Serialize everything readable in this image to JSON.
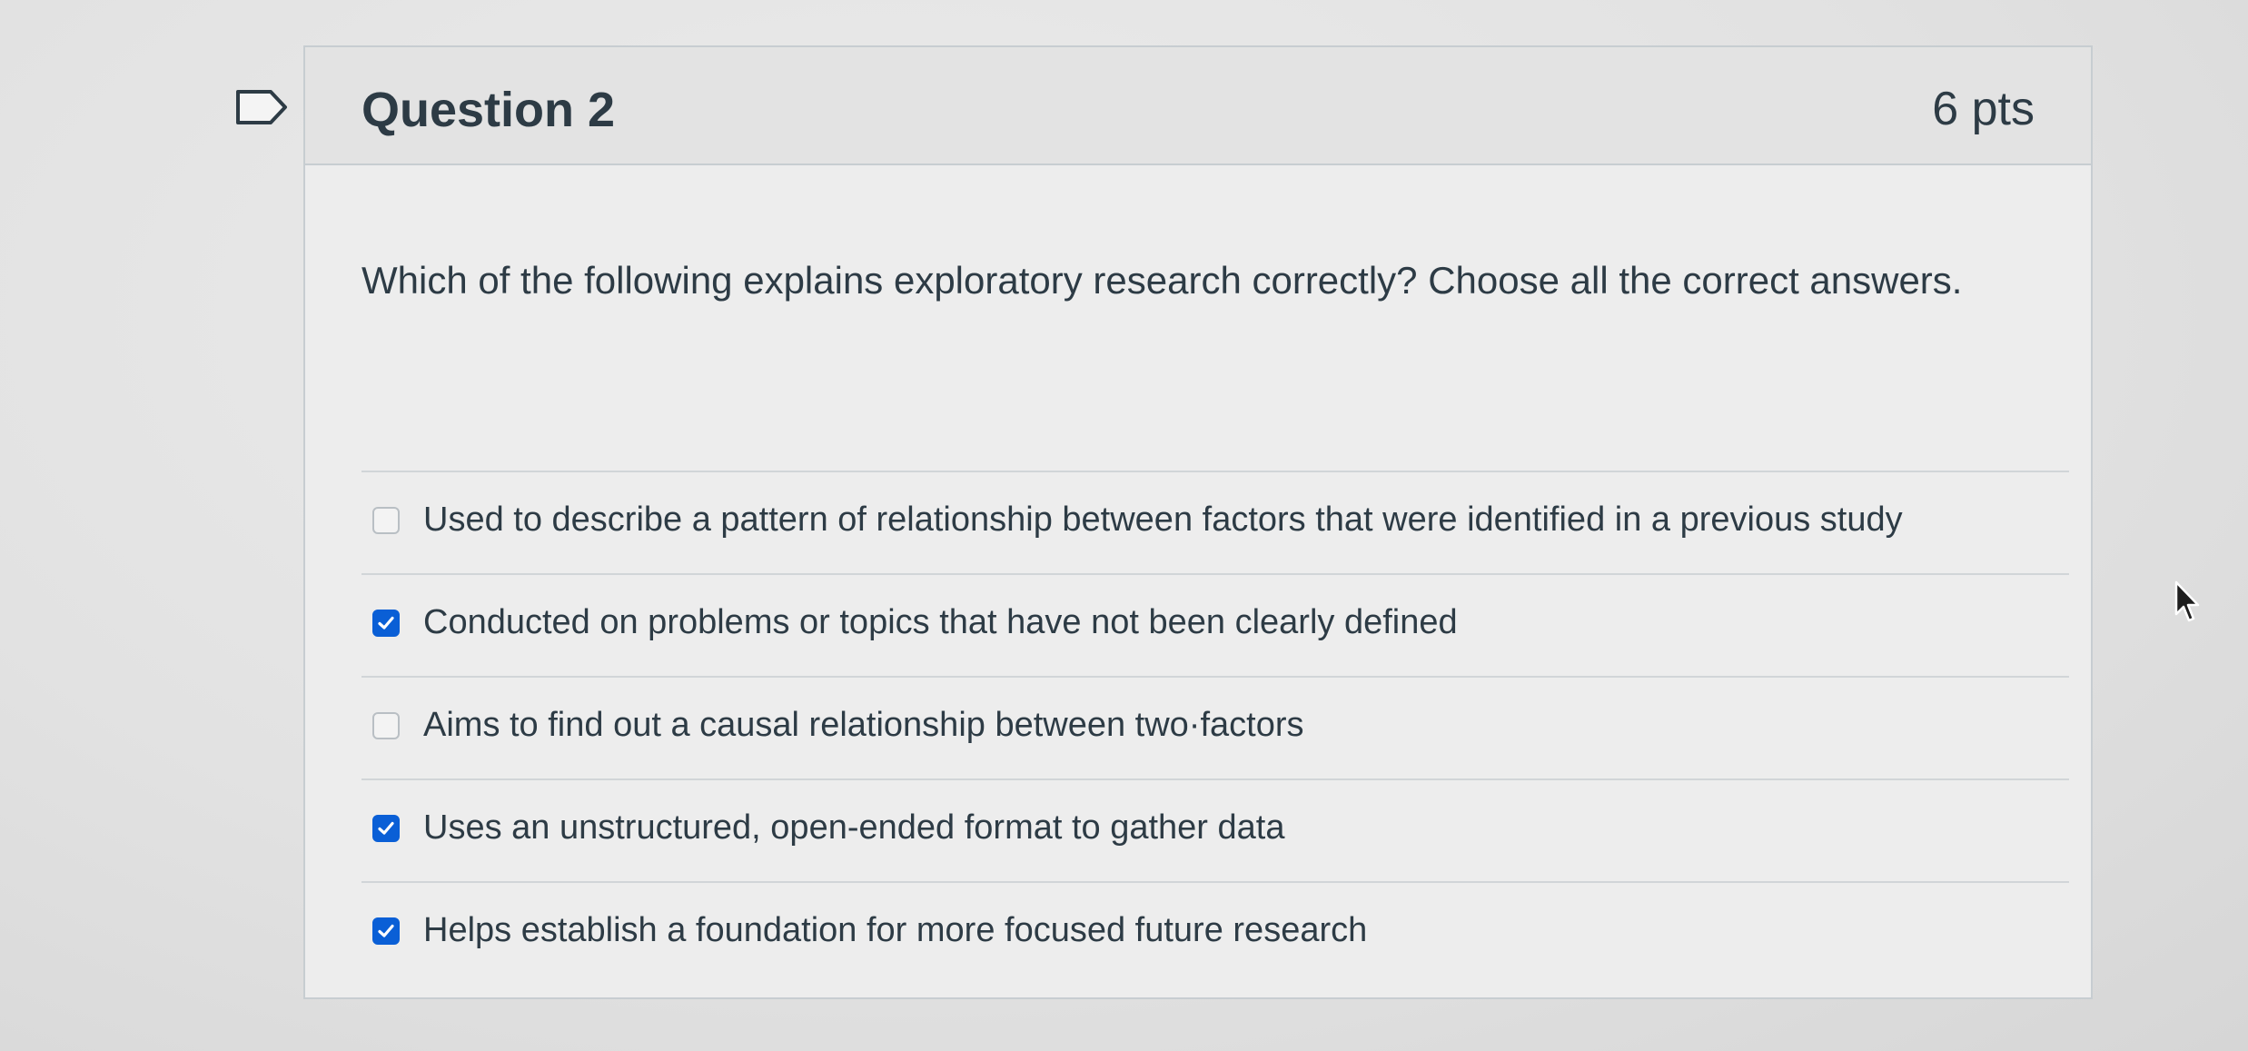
{
  "question": {
    "title": "Question 2",
    "points": "6 pts",
    "text": "Which of the following explains exploratory research correctly? Choose all the correct answers."
  },
  "answers": [
    {
      "label": "Used to describe a pattern of relationship between factors that were identified in a previous study",
      "checked": false
    },
    {
      "label": "Conducted on problems or topics that have not been clearly defined",
      "checked": true
    },
    {
      "label": "Aims to find out a causal relationship between two·factors",
      "checked": false
    },
    {
      "label": "Uses an unstructured, open-ended format to gather data",
      "checked": true
    },
    {
      "label": "Helps establish a foundation for more focused future research",
      "checked": true
    }
  ],
  "colors": {
    "accent": "#0a5fd6",
    "text": "#2d3b45",
    "border": "#c7cdd1"
  },
  "icons": {
    "flag": "bookmark-flag-icon",
    "check": "check-icon",
    "cursor": "mouse-pointer-icon"
  }
}
